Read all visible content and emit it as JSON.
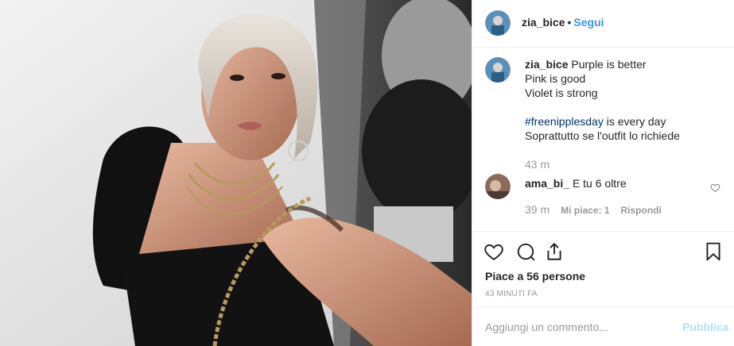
{
  "photo": {
    "alt_description": ""
  },
  "header": {
    "username": "zia_bice",
    "separator": "•",
    "follow_label": "Segui"
  },
  "caption": {
    "username": "zia_bice",
    "lines": [
      "Purple is better",
      "Pink is good",
      "Violet is strong"
    ],
    "hashtag": "#freenipplesday",
    "hashtag_rest": " is every day",
    "last_line": "Soprattutto se l'outfit lo richiede",
    "time": "43 m"
  },
  "comment": {
    "username": "ama_bi_",
    "text": "E tu 6 oltre",
    "time": "39 m",
    "likes_label": "Mi piace: 1",
    "reply_label": "Rispondi"
  },
  "actions": {
    "likes_text": "Piace a 56 persone",
    "timestamp": "43 MINUTI FA"
  },
  "add_comment": {
    "placeholder": "Aggiungi un commento...",
    "publish_label": "Pubblica"
  },
  "colors": {
    "link": "#3897f0",
    "hashtag": "#003569",
    "muted": "#999999",
    "publish_disabled": "#b2dffc"
  },
  "icons": [
    "heart-icon",
    "comment-icon",
    "share-icon",
    "bookmark-icon",
    "small-heart-icon"
  ]
}
